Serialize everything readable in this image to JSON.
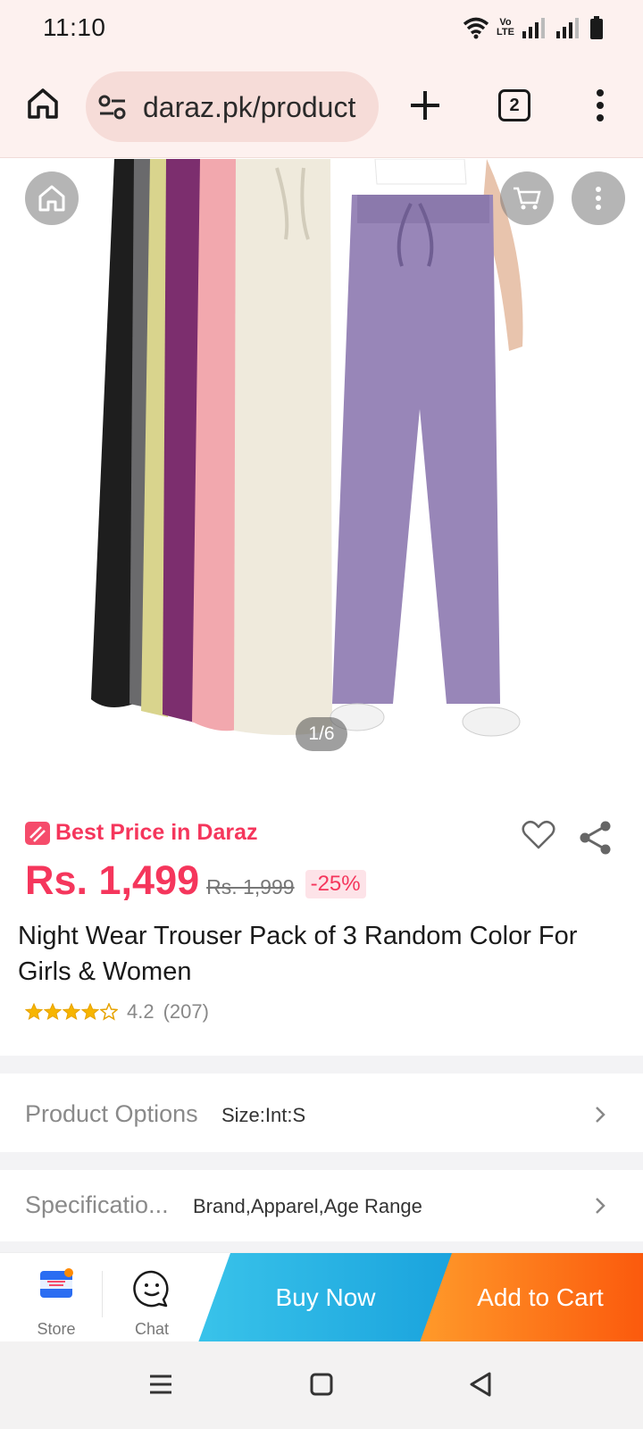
{
  "status_bar": {
    "time": "11:10",
    "volte_top": "Vo",
    "volte_bottom": "LTE"
  },
  "browser": {
    "url": "daraz.pk/product",
    "tab_count": "2"
  },
  "gallery": {
    "page_indicator": "1/6"
  },
  "product": {
    "badge_text": "Best Price in Daraz",
    "price": "Rs. 1,499",
    "original_price": "Rs. 1,999",
    "discount": "-25%",
    "title": "Night Wear Trouser Pack of  3   Random Color For Girls & Women",
    "rating": 4.2,
    "rating_value": "4.2",
    "review_count": "(207)"
  },
  "options": [
    {
      "label": "Product Options",
      "value": "Size:Int:S"
    },
    {
      "label": "Specificatio...",
      "value": "Brand,Apparel,Age Range"
    }
  ],
  "action_bar": {
    "store_label": "Store",
    "chat_label": "Chat",
    "buy_now": "Buy Now",
    "add_to_cart": "Add to Cart"
  },
  "colors": {
    "price_red": "#f5365c",
    "buy_now": "#1aa3dd",
    "add_to_cart": "#fb5a0d",
    "browser_bg": "#fdf1ef"
  }
}
